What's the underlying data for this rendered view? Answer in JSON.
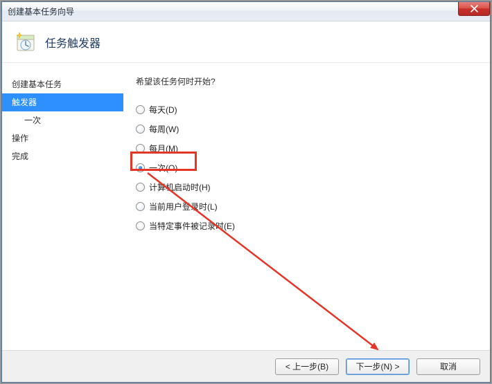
{
  "window": {
    "title": "创建基本任务向导"
  },
  "header": {
    "title": "任务触发器"
  },
  "sidebar": {
    "items": [
      {
        "label": "创建基本任务"
      },
      {
        "label": "触发器"
      },
      {
        "label": "一次"
      },
      {
        "label": "操作"
      },
      {
        "label": "完成"
      }
    ],
    "selected_index": 1
  },
  "content": {
    "prompt": "希望该任务何时开始?",
    "options": [
      {
        "label": "每天(D)"
      },
      {
        "label": "每周(W)"
      },
      {
        "label": "每月(M)"
      },
      {
        "label": "一次(O)"
      },
      {
        "label": "计算机启动时(H)"
      },
      {
        "label": "当前用户登录时(L)"
      },
      {
        "label": "当特定事件被记录时(E)"
      }
    ],
    "selected_option_index": 3
  },
  "footer": {
    "back": "< 上一步(B)",
    "next": "下一步(N) >",
    "cancel": "取消"
  },
  "annotation": {
    "highlight_option_index": 3,
    "arrow_target": "next-button",
    "arrow_color": "#e53527"
  }
}
